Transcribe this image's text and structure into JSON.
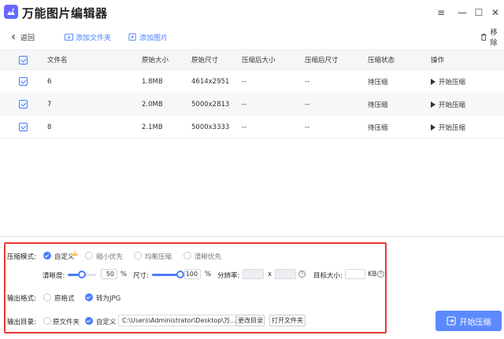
{
  "app": {
    "title": "万能图片编辑器"
  },
  "window_controls": {
    "menu": "≡",
    "minimize": "—",
    "maximize": "☐",
    "close": "✕"
  },
  "toolbar": {
    "back_label": "返回",
    "add_folder_label": "添加文件夹",
    "add_image_label": "添加图片",
    "remove_label": "移除"
  },
  "table": {
    "headers": {
      "name": "文件名",
      "orig_size": "原始大小",
      "orig_dim": "原始尺寸",
      "comp_size": "压缩后大小",
      "comp_dim": "压缩后尺寸",
      "status": "压缩状态",
      "action": "操作"
    },
    "rows": [
      {
        "name": "6",
        "orig_size": "1.8MB",
        "orig_dim": "4614x2951",
        "comp_size": "--",
        "comp_dim": "--",
        "status": "待压缩",
        "action": "开始压缩"
      },
      {
        "name": "7",
        "orig_size": "2.0MB",
        "orig_dim": "5000x2813",
        "comp_size": "--",
        "comp_dim": "--",
        "status": "待压缩",
        "action": "开始压缩"
      },
      {
        "name": "8",
        "orig_size": "2.1MB",
        "orig_dim": "5000x3333",
        "comp_size": "--",
        "comp_dim": "--",
        "status": "待压缩",
        "action": "开始压缩"
      }
    ]
  },
  "settings": {
    "mode_label": "压缩模式:",
    "modes": [
      "自定义",
      "缩小优先",
      "均衡压缩",
      "清晰优先"
    ],
    "selected_mode": "自定义",
    "clarity_label": "清晰度:",
    "clarity_value": "50",
    "clarity_fraction": 0.5,
    "percent_unit": "%",
    "size_label": "尺寸:",
    "size_value": "100",
    "size_fraction": 1.0,
    "resolution_label": "分辨率:",
    "resolution_x": "",
    "resolution_sep": "x",
    "resolution_y": "",
    "target_size_label": "目标大小:",
    "target_size_value": "",
    "target_size_unit": "KB",
    "help_glyph": "?",
    "format_label": "输出格式:",
    "formats": [
      "原格式",
      "转为JPG"
    ],
    "selected_format": "转为JPG",
    "output_dir_label": "输出目录:",
    "output_dirs": [
      "原文件夹",
      "自定义"
    ],
    "selected_output_dir": "自定义",
    "output_path": "C:\\Users\\Administrator\\Desktop\\万...",
    "change_dir_label": "更改目录",
    "open_folder_label": "打开文件夹"
  },
  "start_button": {
    "label": "开始压缩"
  },
  "colors": {
    "accent": "#4a7dff",
    "highlight_border": "#e53935",
    "start_button": "#5b8aff"
  }
}
